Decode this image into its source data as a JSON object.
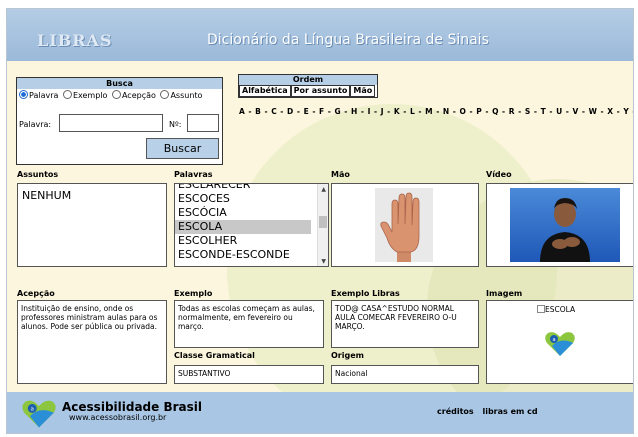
{
  "header": {
    "logo": "LIBRAS",
    "title": "Dicionário da Língua Brasileira de Sinais"
  },
  "busca": {
    "title": "Busca",
    "options": [
      {
        "label": "Palavra",
        "checked": true
      },
      {
        "label": "Exemplo",
        "checked": false
      },
      {
        "label": "Acepção",
        "checked": false
      },
      {
        "label": "Assunto",
        "checked": false
      }
    ],
    "palavra_label": "Palavra:",
    "palavra_value": "",
    "numero_label": "Nº:",
    "numero_value": "",
    "button": "Buscar"
  },
  "ordem": {
    "title": "Ordem",
    "tabs": [
      "Alfabética",
      "Por assunto",
      "Mão"
    ]
  },
  "alphabet": "A - B - C - D - E - F - G - H - I - J - K - L - M - N - O - P - Q - R - S - T - U - V - W - X - Y - Z",
  "sections": {
    "assuntos": "Assuntos",
    "palavras": "Palavras",
    "mao": "Mão",
    "video": "Vídeo",
    "acepcao": "Acepção",
    "exemplo": "Exemplo",
    "exemplo_libras": "Exemplo Libras",
    "imagem": "Imagem",
    "classe": "Classe Gramatical",
    "origem": "Origem"
  },
  "assuntos_value": "NENHUM",
  "palavras": [
    {
      "label": "ESCLARECER",
      "selected": false
    },
    {
      "label": "ESCOCES",
      "selected": false
    },
    {
      "label": "ESCÓCIA",
      "selected": false
    },
    {
      "label": "ESCOLA",
      "selected": true
    },
    {
      "label": "ESCOLHER",
      "selected": false
    },
    {
      "label": "ESCONDE-ESCONDE",
      "selected": false
    }
  ],
  "acepcao_text": "Instituição de ensino, onde os professores ministram aulas para os alunos. Pode ser pública ou privada.",
  "exemplo_text": "Todas as escolas começam as aulas, normalmente, em fevereiro ou março.",
  "exemplo_libras_text": "TOD@ CASA^ESTUDO NORMAL AULA COMECAR FEVEREIRO O-U MARÇO.",
  "imagem_alt": "ESCOLA",
  "classe_value": "SUBSTANTIVO",
  "origem_value": "Nacional",
  "footer": {
    "title": "Acessibilidade Brasil",
    "url": "www.acessobrasil.org.br",
    "links": [
      "créditos",
      "libras em cd"
    ]
  },
  "colors": {
    "header": "#9bb9d9",
    "background": "#fbf6dd",
    "accent": "#b6cfe6"
  }
}
